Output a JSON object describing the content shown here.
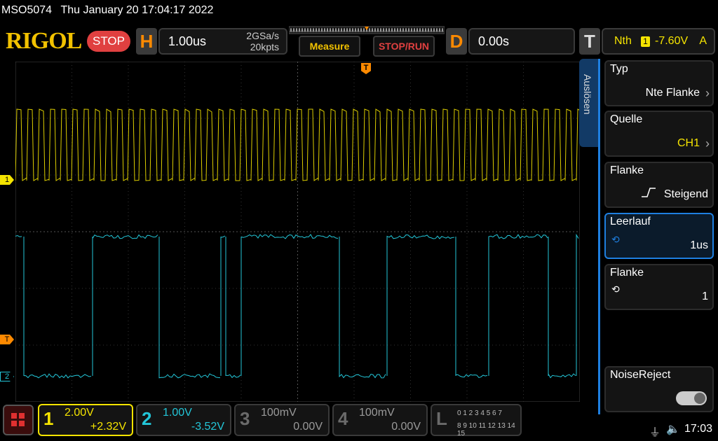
{
  "title": {
    "model": "MSO5074",
    "datetime": "Thu January 20 17:04:17 2022"
  },
  "brand": {
    "logo": "RIGOL",
    "run_state": "STOP"
  },
  "horizontal": {
    "letter": "H",
    "timebase": "1.00us",
    "sample_rate": "2GSa/s",
    "memory": "20kpts"
  },
  "buttons": {
    "measure": "Measure",
    "stop_run": "STOP/RUN"
  },
  "delay": {
    "letter": "D",
    "value": "0.00s"
  },
  "trigger": {
    "letter": "T",
    "mode": "Nth",
    "source_badge": "1",
    "level": "-7.60V",
    "sweep": "A"
  },
  "markers": {
    "ch1": "1",
    "ch2": "2",
    "trig": "T",
    "trig_top": "T"
  },
  "side_tab": "Auslösen",
  "menu": [
    {
      "label": "Typ",
      "value": "Nte Flanke"
    },
    {
      "label": "Quelle",
      "value": "CH1"
    },
    {
      "label": "Flanke",
      "value": "Steigend"
    },
    {
      "label": "Leerlauf",
      "value": "1us"
    },
    {
      "label": "Flanke",
      "value": "1"
    },
    {
      "label": "NoiseReject",
      "value": ""
    }
  ],
  "channels": [
    {
      "num": "1",
      "scale": "2.00V",
      "offset": "+2.32V",
      "color": "#f5e400"
    },
    {
      "num": "2",
      "scale": "1.00V",
      "offset": "-3.52V",
      "color": "#23c6d8"
    },
    {
      "num": "3",
      "scale": "100mV",
      "offset": "0.00V",
      "color": "#6a6a6a"
    },
    {
      "num": "4",
      "scale": "100mV",
      "offset": "0.00V",
      "color": "#6a6a6a"
    }
  ],
  "logic": {
    "letter": "L",
    "row1": "0 1 2 3  4 5 6 7",
    "row2": "8 9 10 11 12 13 14 15"
  },
  "status": {
    "time": "17:03"
  },
  "colors": {
    "ch1": "#f5e400",
    "ch2": "#23c6d8",
    "accent": "#ff8a00",
    "stop": "#e04040",
    "active": "#1e7fe0"
  }
}
